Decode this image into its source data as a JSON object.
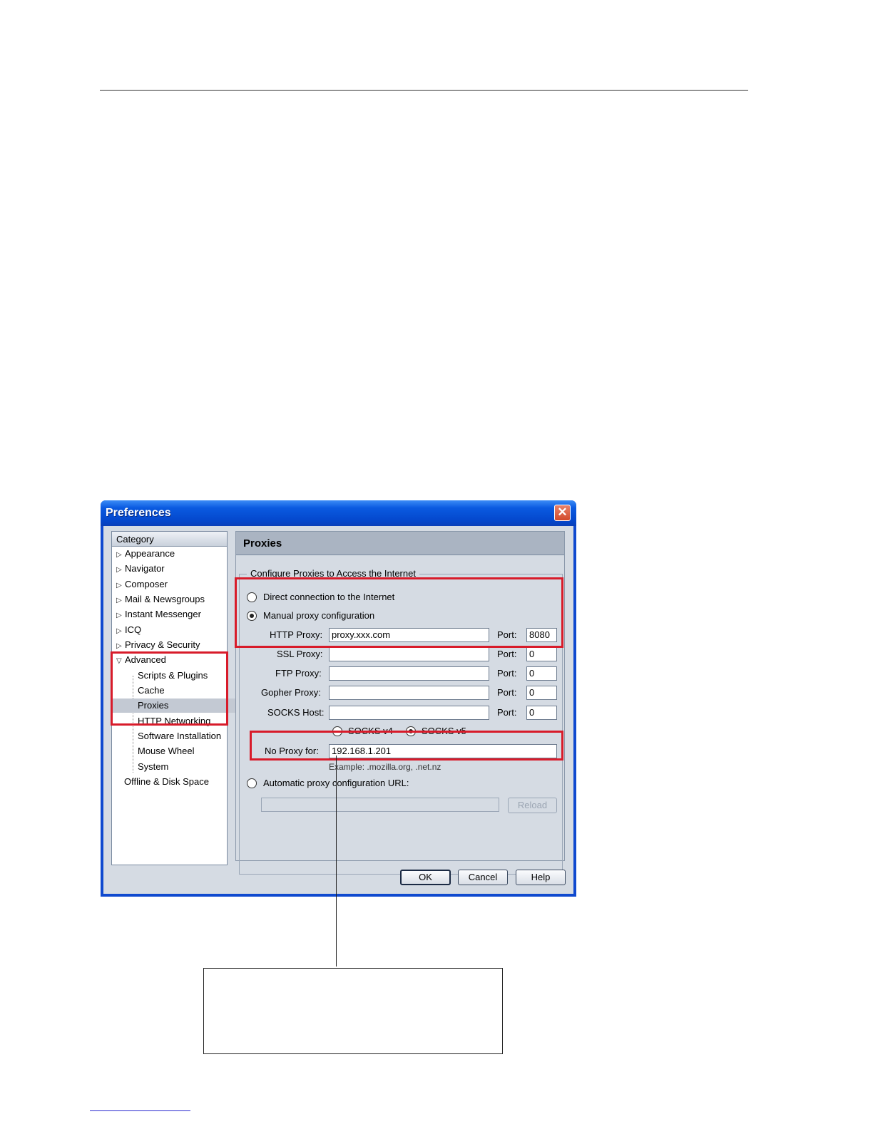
{
  "dialog": {
    "title": "Preferences",
    "close_glyph": "✕"
  },
  "tree": {
    "header": "Category",
    "items": [
      {
        "label": "Appearance"
      },
      {
        "label": "Navigator"
      },
      {
        "label": "Composer"
      },
      {
        "label": "Mail & Newsgroups"
      },
      {
        "label": "Instant Messenger"
      },
      {
        "label": "ICQ"
      },
      {
        "label": "Privacy & Security"
      },
      {
        "label": "Advanced"
      },
      {
        "label": "Scripts & Plugins"
      },
      {
        "label": "Cache"
      },
      {
        "label": "Proxies"
      },
      {
        "label": "HTTP Networking"
      },
      {
        "label": "Software Installation"
      },
      {
        "label": "Mouse Wheel"
      },
      {
        "label": "System"
      },
      {
        "label": "Offline & Disk Space"
      }
    ],
    "collapsed_arrow": "▷",
    "expanded_arrow": "▽"
  },
  "panel": {
    "title": "Proxies",
    "group_label": "Configure Proxies to Access the Internet",
    "direct_label": "Direct connection to the Internet",
    "manual_label": "Manual proxy configuration",
    "http_label": "HTTP Proxy:",
    "http_value": "proxy.xxx.com",
    "http_port": "8080",
    "ssl_label": "SSL Proxy:",
    "ssl_value": "",
    "ssl_port": "0",
    "ftp_label": "FTP Proxy:",
    "ftp_value": "",
    "ftp_port": "0",
    "gopher_label": "Gopher Proxy:",
    "gopher_value": "",
    "gopher_port": "0",
    "socks_label": "SOCKS Host:",
    "socks_value": "",
    "socks_port": "0",
    "port_label": "Port:",
    "socks_v4": "SOCKS v4",
    "socks_v5": "SOCKS v5",
    "no_proxy_label": "No Proxy for:",
    "no_proxy_value": "192.168.1.201",
    "example": "Example: .mozilla.org, .net.nz",
    "auto_label": "Automatic proxy configuration URL:",
    "auto_value": "",
    "reload": "Reload"
  },
  "buttons": {
    "ok": "OK",
    "cancel": "Cancel",
    "help": "Help"
  },
  "colors": {
    "highlight": "#d81b2a",
    "titlebar": "#0a5ae0"
  }
}
